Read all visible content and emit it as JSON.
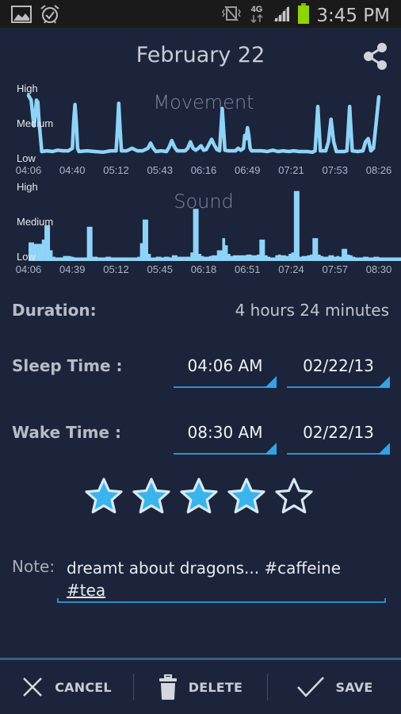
{
  "status_bar": {
    "time": "3:45 PM",
    "network": "4G",
    "icons": [
      "gallery-icon",
      "alarm-icon",
      "vibrate-mute-icon",
      "4g-data-icon",
      "signal-icon",
      "battery-icon"
    ]
  },
  "header": {
    "title": "February 22",
    "share_icon": "share-icon"
  },
  "charts": {
    "movement": {
      "title": "Movement",
      "y_labels": [
        "High",
        "Medium",
        "Low"
      ],
      "x_labels": [
        "04:06",
        "04:40",
        "05:12",
        "05:43",
        "06:16",
        "06:49",
        "07:21",
        "07:53",
        "08:26"
      ]
    },
    "sound": {
      "title": "Sound",
      "y_labels": [
        "High",
        "Medium",
        "Low"
      ],
      "x_labels": [
        "04:06",
        "04:39",
        "05:12",
        "05:45",
        "06:18",
        "06:51",
        "07:24",
        "07:57",
        "08:30"
      ]
    }
  },
  "chart_data": [
    {
      "type": "line",
      "title": "Movement",
      "xlabel": "",
      "ylabel": "",
      "y_categories": [
        "Low",
        "Medium",
        "High"
      ],
      "ylim": [
        0,
        1
      ],
      "x_ticks": [
        "04:06",
        "04:40",
        "05:12",
        "05:43",
        "06:16",
        "06:49",
        "07:21",
        "07:53",
        "08:26"
      ],
      "x_range_minutes": [
        0,
        264
      ],
      "grid": false,
      "series": [
        {
          "name": "Movement",
          "points": [
            [
              0,
              0.92
            ],
            [
              2,
              0.85
            ],
            [
              4,
              0.45
            ],
            [
              5,
              0.6
            ],
            [
              6,
              0.85
            ],
            [
              7,
              0.82
            ],
            [
              8,
              0.5
            ],
            [
              10,
              0.05
            ],
            [
              14,
              0.06
            ],
            [
              18,
              0.05
            ],
            [
              22,
              0.07
            ],
            [
              26,
              0.06
            ],
            [
              30,
              0.06
            ],
            [
              33,
              0.1
            ],
            [
              34,
              0.5
            ],
            [
              35,
              0.78
            ],
            [
              36,
              0.5
            ],
            [
              37,
              0.1
            ],
            [
              38,
              0.05
            ],
            [
              44,
              0.06
            ],
            [
              50,
              0.05
            ],
            [
              56,
              0.04
            ],
            [
              62,
              0.06
            ],
            [
              66,
              0.06
            ],
            [
              67,
              0.4
            ],
            [
              68,
              0.8
            ],
            [
              69,
              0.4
            ],
            [
              70,
              0.06
            ],
            [
              74,
              0.06
            ],
            [
              78,
              0.1
            ],
            [
              82,
              0.06
            ],
            [
              86,
              0.06
            ],
            [
              90,
              0.1
            ],
            [
              92,
              0.18
            ],
            [
              94,
              0.1
            ],
            [
              96,
              0.05
            ],
            [
              100,
              0.06
            ],
            [
              104,
              0.05
            ],
            [
              106,
              0.12
            ],
            [
              108,
              0.22
            ],
            [
              110,
              0.12
            ],
            [
              112,
              0.06
            ],
            [
              118,
              0.06
            ],
            [
              120,
              0.1
            ],
            [
              122,
              0.2
            ],
            [
              124,
              0.1
            ],
            [
              126,
              0.07
            ],
            [
              128,
              0.1
            ],
            [
              130,
              0.14
            ],
            [
              132,
              0.07
            ],
            [
              134,
              0.08
            ],
            [
              136,
              0.16
            ],
            [
              138,
              0.24
            ],
            [
              140,
              0.15
            ],
            [
              142,
              0.08
            ],
            [
              144,
              0.06
            ],
            [
              145,
              0.4
            ],
            [
              146,
              0.72
            ],
            [
              147,
              0.4
            ],
            [
              148,
              0.07
            ],
            [
              150,
              0.06
            ],
            [
              154,
              0.06
            ],
            [
              156,
              0.06
            ],
            [
              158,
              0.1
            ],
            [
              160,
              0.07
            ],
            [
              162,
              0.1
            ],
            [
              163,
              0.3
            ],
            [
              164,
              0.25
            ],
            [
              165,
              0.42
            ],
            [
              166,
              0.3
            ],
            [
              167,
              0.1
            ],
            [
              168,
              0.06
            ],
            [
              176,
              0.06
            ],
            [
              180,
              0.05
            ],
            [
              184,
              0.07
            ],
            [
              188,
              0.05
            ],
            [
              192,
              0.06
            ],
            [
              196,
              0.05
            ],
            [
              200,
              0.06
            ],
            [
              204,
              0.05
            ],
            [
              210,
              0.05
            ],
            [
              214,
              0.04
            ],
            [
              216,
              0.06
            ],
            [
              217,
              0.4
            ],
            [
              218,
              0.75
            ],
            [
              219,
              0.4
            ],
            [
              220,
              0.06
            ],
            [
              224,
              0.06
            ],
            [
              226,
              0.2
            ],
            [
              228,
              0.55
            ],
            [
              230,
              0.2
            ],
            [
              232,
              0.05
            ],
            [
              238,
              0.05
            ],
            [
              240,
              0.06
            ],
            [
              241,
              0.4
            ],
            [
              242,
              0.75
            ],
            [
              243,
              0.4
            ],
            [
              244,
              0.06
            ],
            [
              248,
              0.05
            ],
            [
              252,
              0.06
            ],
            [
              254,
              0.2
            ],
            [
              256,
              0.25
            ],
            [
              258,
              0.06
            ],
            [
              260,
              0.1
            ],
            [
              262,
              0.5
            ],
            [
              264,
              0.9
            ]
          ]
        }
      ]
    },
    {
      "type": "bar",
      "title": "Sound",
      "xlabel": "",
      "ylabel": "",
      "y_categories": [
        "Low",
        "Medium",
        "High"
      ],
      "ylim": [
        0,
        1
      ],
      "x_ticks": [
        "04:06",
        "04:39",
        "05:12",
        "05:45",
        "06:18",
        "06:51",
        "07:24",
        "07:57",
        "08:30"
      ],
      "x_range_minutes": [
        0,
        264
      ],
      "grid": false,
      "series": [
        {
          "name": "Sound",
          "bin_minutes": 2,
          "values": [
            0.26,
            0.26,
            0.24,
            0.24,
            0.24,
            0.3,
            0.5,
            0.5,
            0.15,
            0.06,
            0.05,
            0.05,
            0.05,
            0.07,
            0.07,
            0.07,
            0.06,
            0.05,
            0.05,
            0.05,
            0.05,
            0.05,
            0.48,
            0.48,
            0.06,
            0.06,
            0.05,
            0.05,
            0.05,
            0.06,
            0.06,
            0.05,
            0.05,
            0.05,
            0.05,
            0.05,
            0.05,
            0.05,
            0.05,
            0.05,
            0.05,
            0.06,
            0.25,
            0.58,
            0.58,
            0.1,
            0.05,
            0.05,
            0.06,
            0.06,
            0.05,
            0.06,
            0.06,
            0.05,
            0.08,
            0.08,
            0.06,
            0.06,
            0.06,
            0.06,
            0.06,
            0.12,
            0.73,
            0.73,
            0.1,
            0.07,
            0.06,
            0.06,
            0.07,
            0.08,
            0.08,
            0.15,
            0.15,
            0.32,
            0.22,
            0.1,
            0.07,
            0.08,
            0.08,
            0.08,
            0.08,
            0.08,
            0.09,
            0.09,
            0.08,
            0.08,
            0.09,
            0.3,
            0.3,
            0.08,
            0.06,
            0.05,
            0.05,
            0.08,
            0.09,
            0.08,
            0.08,
            0.07,
            0.1,
            0.12,
            0.98,
            0.98,
            0.06,
            0.07,
            0.07,
            0.08,
            0.09,
            0.32,
            0.32,
            0.09,
            0.07,
            0.06,
            0.06,
            0.08,
            0.08,
            0.06,
            0.07,
            0.06,
            0.17,
            0.17,
            0.09,
            0.08,
            0.06,
            0.05,
            0.05,
            0.05,
            0.06,
            0.06,
            0.05,
            0.05,
            0.06,
            0.06,
            0.05,
            0.05,
            0.05,
            0.05,
            0.05,
            0.05,
            0.05,
            0.05,
            0.05,
            0.06,
            0.06,
            0.05,
            0.05,
            0.05,
            0.05,
            0.05,
            0.05,
            0.05,
            0.05,
            0.06,
            0.06,
            0.05,
            0.05,
            0.05,
            0.05,
            0.06,
            0.06,
            0.06,
            0.05,
            0.05,
            0.05,
            0.05,
            0.05,
            0.05,
            0.05,
            0.05,
            0.05,
            0.05,
            0.05,
            0.06,
            0.06,
            0.06,
            0.06,
            0.06,
            0.06,
            0.06,
            0.06,
            0.06,
            0.06,
            0.06,
            0.06,
            0.06,
            0.06,
            0.06,
            0.07,
            0.07,
            0.06,
            0.06,
            0.06,
            0.06,
            0.06,
            0.06,
            0.06,
            0.06,
            0.06,
            0.06,
            0.06,
            0.06,
            0.08,
            0.38,
            0.87,
            0.87,
            0.1,
            0.07,
            0.07,
            0.08,
            0.08,
            0.08,
            0.08,
            0.08,
            0.1,
            0.12,
            0.12,
            0.07,
            0.06,
            0.06,
            0.06,
            0.06,
            0.05,
            0.05,
            0.05,
            0.07,
            0.07,
            0.06,
            0.08,
            0.08,
            0.06,
            0.05,
            0.05,
            0.05,
            0.05,
            0.06,
            0.06,
            0.06,
            0.06,
            0.06,
            0.06,
            0.06,
            0.06,
            0.05,
            0.05,
            0.05,
            0.05,
            0.06,
            0.06,
            0.05,
            0.05,
            0.06,
            0.06,
            0.06,
            0.07,
            0.07,
            0.07,
            0.06,
            0.06,
            0.06,
            0.06,
            0.06,
            0.11,
            0.11,
            0.06,
            0.06
          ]
        }
      ]
    }
  ],
  "summary": {
    "duration_label": "Duration:",
    "duration_value": "4 hours 24 minutes",
    "sleep_label": "Sleep Time :",
    "sleep_time": "04:06 AM",
    "sleep_date": "02/22/13",
    "wake_label": "Wake Time :",
    "wake_time": "08:30 AM",
    "wake_date": "02/22/13"
  },
  "rating": {
    "value": 4,
    "max": 5,
    "filled_color": "#3ab4ea",
    "outline_color": "#d6e8f4"
  },
  "note": {
    "label": "Note:",
    "text": "dreamt about dragons... #caffeine",
    "tag_line": "#tea"
  },
  "actions": {
    "cancel": "CANCEL",
    "delete": "DELETE",
    "save": "SAVE"
  },
  "colors": {
    "background": "#1b243a",
    "chart_series": "#8fd3f8",
    "accent": "#33a3e6"
  }
}
